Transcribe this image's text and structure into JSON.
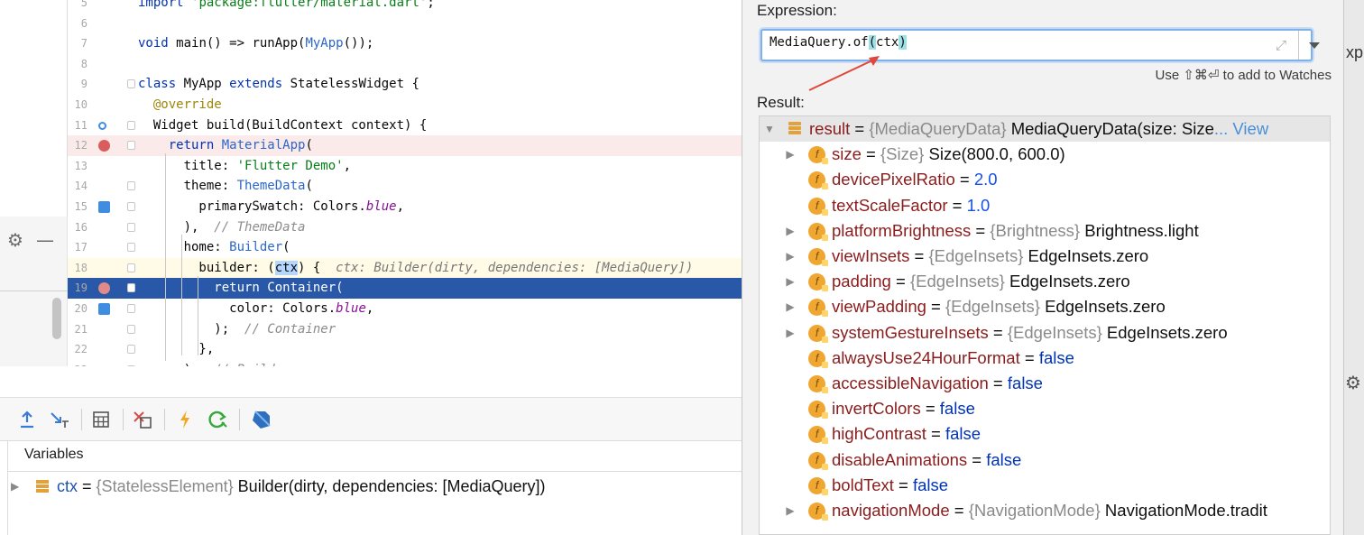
{
  "editor": {
    "lines": [
      {
        "n": "5",
        "tokens": [
          [
            "kw",
            "import "
          ],
          [
            "str",
            "'package:flutter/material.dart'"
          ],
          [
            "",
            "; "
          ]
        ]
      },
      {
        "n": "6",
        "tokens": []
      },
      {
        "n": "7",
        "tokens": [
          [
            "kw",
            "void "
          ],
          [
            "",
            "main() => runApp("
          ],
          [
            "cls",
            "MyApp"
          ],
          [
            "",
            "());"
          ]
        ]
      },
      {
        "n": "8",
        "tokens": []
      },
      {
        "n": "9",
        "tokens": [
          [
            "kw",
            "class "
          ],
          [
            "",
            "MyApp "
          ],
          [
            "kw",
            "extends "
          ],
          [
            "",
            "StatelessWidget {"
          ]
        ]
      },
      {
        "n": "10",
        "tokens": [
          [
            "",
            "  "
          ],
          [
            "ann",
            "@override"
          ]
        ]
      },
      {
        "n": "11",
        "tokens": [
          [
            "",
            "  Widget build(BuildContext context) {"
          ]
        ]
      },
      {
        "n": "12",
        "tokens": [
          [
            "",
            "    "
          ],
          [
            "kw",
            "return "
          ],
          [
            "cls",
            "MaterialApp"
          ],
          [
            "",
            "("
          ]
        ]
      },
      {
        "n": "13",
        "tokens": [
          [
            "",
            "      title: "
          ],
          [
            "str",
            "'Flutter Demo'"
          ],
          [
            "",
            ","
          ]
        ]
      },
      {
        "n": "14",
        "tokens": [
          [
            "",
            "      theme: "
          ],
          [
            "cls",
            "ThemeData"
          ],
          [
            "",
            "("
          ]
        ]
      },
      {
        "n": "15",
        "tokens": [
          [
            "",
            "        primarySwatch: Colors."
          ],
          [
            "fld",
            "blue"
          ],
          [
            "",
            ","
          ]
        ]
      },
      {
        "n": "16",
        "tokens": [
          [
            "",
            "      ),  "
          ],
          [
            "cmt",
            "// ThemeData"
          ]
        ]
      },
      {
        "n": "17",
        "tokens": [
          [
            "",
            "      home: "
          ],
          [
            "cls",
            "Builder"
          ],
          [
            "",
            "("
          ]
        ]
      },
      {
        "n": "18",
        "tokens": [
          [
            "",
            "        builder: ("
          ],
          [
            "sel",
            "ctx"
          ],
          [
            "",
            ") {  "
          ],
          [
            "hint",
            "ctx: Builder(dirty, dependencies: [MediaQuery])"
          ]
        ]
      },
      {
        "n": "19",
        "tokens": [
          [
            "",
            "          return Container("
          ]
        ]
      },
      {
        "n": "20",
        "tokens": [
          [
            "",
            "            color: Colors."
          ],
          [
            "fld",
            "blue"
          ],
          [
            "",
            ","
          ]
        ]
      },
      {
        "n": "21",
        "tokens": [
          [
            "",
            "          );  "
          ],
          [
            "cmt",
            "// Container"
          ]
        ]
      },
      {
        "n": "22",
        "tokens": [
          [
            "",
            "        },"
          ]
        ]
      },
      {
        "n": "23",
        "tokens": [
          [
            "",
            "      ),  "
          ],
          [
            "cmt",
            "// Builder"
          ]
        ]
      }
    ]
  },
  "icons": {
    "settings": "gear-icon",
    "collapse": "minus-icon",
    "step_out": "step-out-icon",
    "run_to_cursor": "run-to-cursor-icon",
    "evaluate": "calculator-icon",
    "mute_breakpoints": "mute-breakpoints-icon",
    "hot_reload": "lightning-icon",
    "hot_restart": "restart-icon",
    "dart_devtools": "dart-icon"
  },
  "variables": {
    "title": "Variables",
    "rows": [
      {
        "name": "ctx",
        "type": "{StatelessElement}",
        "value": "Builder(dirty, dependencies: [MediaQuery])"
      }
    ]
  },
  "evaluate": {
    "expression_label": "Expression:",
    "expression_pre": "MediaQuery.of",
    "expression_paren_open": "(",
    "expression_arg": "ctx",
    "expression_paren_close": ")",
    "watches_hint": "Use ⇧⌘⏎ to add to Watches",
    "result_label": "Result:",
    "root": {
      "name": "result",
      "type": "{MediaQueryData}",
      "value": "MediaQueryData(size: Size",
      "ellipsis": "...",
      "link": "View"
    },
    "fields": [
      {
        "name": "size",
        "type": "{Size}",
        "value": "Size(800.0, 600.0)",
        "kind": "obj",
        "expandable": true
      },
      {
        "name": "devicePixelRatio",
        "type": "",
        "value": "2.0",
        "kind": "num",
        "expandable": false
      },
      {
        "name": "textScaleFactor",
        "type": "",
        "value": "1.0",
        "kind": "num",
        "expandable": false
      },
      {
        "name": "platformBrightness",
        "type": "{Brightness}",
        "value": "Brightness.light",
        "kind": "obj",
        "expandable": true
      },
      {
        "name": "viewInsets",
        "type": "{EdgeInsets}",
        "value": "EdgeInsets.zero",
        "kind": "obj",
        "expandable": true
      },
      {
        "name": "padding",
        "type": "{EdgeInsets}",
        "value": "EdgeInsets.zero",
        "kind": "obj",
        "expandable": true
      },
      {
        "name": "viewPadding",
        "type": "{EdgeInsets}",
        "value": "EdgeInsets.zero",
        "kind": "obj",
        "expandable": true
      },
      {
        "name": "systemGestureInsets",
        "type": "{EdgeInsets}",
        "value": "EdgeInsets.zero",
        "kind": "obj",
        "expandable": true
      },
      {
        "name": "alwaysUse24HourFormat",
        "type": "",
        "value": "false",
        "kind": "bool",
        "expandable": false
      },
      {
        "name": "accessibleNavigation",
        "type": "",
        "value": "false",
        "kind": "bool",
        "expandable": false
      },
      {
        "name": "invertColors",
        "type": "",
        "value": "false",
        "kind": "bool",
        "expandable": false
      },
      {
        "name": "highContrast",
        "type": "",
        "value": "false",
        "kind": "bool",
        "expandable": false
      },
      {
        "name": "disableAnimations",
        "type": "",
        "value": "false",
        "kind": "bool",
        "expandable": false
      },
      {
        "name": "boldText",
        "type": "",
        "value": "false",
        "kind": "bool",
        "expandable": false
      },
      {
        "name": "navigationMode",
        "type": "{NavigationMode}",
        "value": "NavigationMode.tradit",
        "kind": "obj",
        "expandable": true
      }
    ]
  },
  "right_strip": {
    "peek_text": "xpl"
  },
  "colors": {
    "exec_line": "#2a58a8",
    "breakpoint": "#db5c5c",
    "field_icon": "#f0a732",
    "focus_border": "#7fb0ea",
    "arrow": "#e0463a"
  }
}
